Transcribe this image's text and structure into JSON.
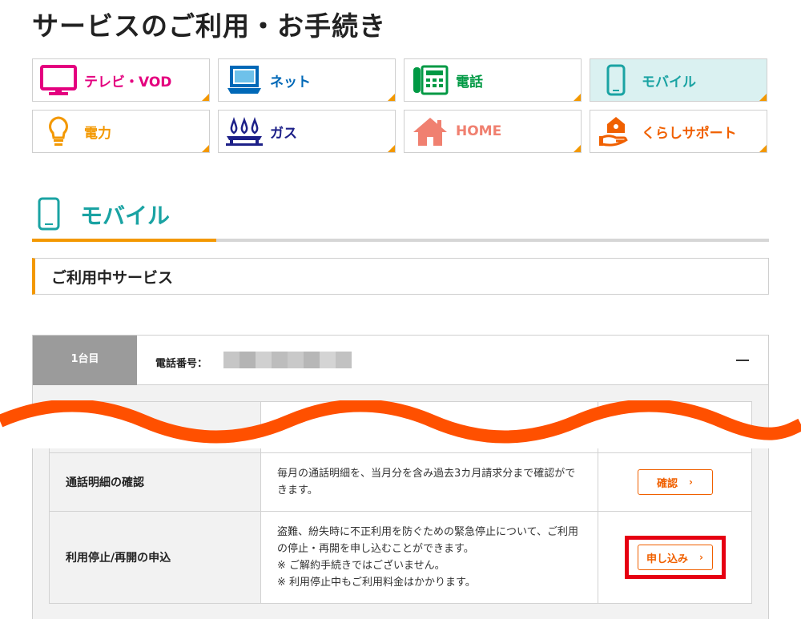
{
  "page": {
    "title": "サービスのご利用・お手続き"
  },
  "categories": [
    {
      "label": "テレビ・VOD",
      "icon": "tv-icon",
      "color": "#e4007f"
    },
    {
      "label": "ネット",
      "icon": "laptop-icon",
      "color": "#0068b7"
    },
    {
      "label": "電話",
      "icon": "phone-icon",
      "color": "#009944"
    },
    {
      "label": "モバイル",
      "icon": "smartphone-icon",
      "color": "#1aa3a3"
    },
    {
      "label": "電力",
      "icon": "lightbulb-icon",
      "color": "#f39800"
    },
    {
      "label": "ガス",
      "icon": "gas-flame-icon",
      "color": "#1d2088"
    },
    {
      "label": "HOME",
      "icon": "house-icon",
      "color": "#f08070"
    },
    {
      "label": "くらしサポート",
      "icon": "hand-house-icon",
      "color": "#f06000"
    }
  ],
  "section": {
    "title": "モバイル",
    "icon": "smartphone-icon"
  },
  "subsection": {
    "title": "ご利用中サービス"
  },
  "device": {
    "tab_label": "1台目",
    "phone_label": "電話番号：",
    "collapse_icon": "minus-icon"
  },
  "services": [
    {
      "name": "通話明細の確認",
      "description": "毎月の通話明細を、当月分を含み過去3カ月請求分まで確認ができます。",
      "button": "確認"
    },
    {
      "name": "利用停止/再開の申込",
      "description_lines": [
        "盗難、紛失時に不正利用を防ぐための緊急停止について、ご利用の停止・再開を申し込むことができます。",
        "※ ご解約手続きではございません。",
        "※ 利用停止中もご利用料金はかかります。"
      ],
      "button": "申し込み"
    }
  ],
  "colors": {
    "accent": "#f39800",
    "button": "#f06000",
    "highlight": "#e60012",
    "wave": "#ff5000"
  }
}
